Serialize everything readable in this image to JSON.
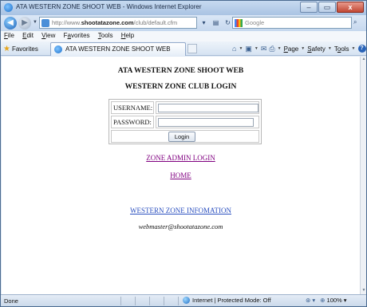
{
  "window": {
    "title": "ATA WESTERN ZONE SHOOT WEB - Windows Internet Explorer",
    "minimize": "–",
    "maximize": "▭",
    "close": "x"
  },
  "address": {
    "url_prefix": "http://www.",
    "url_domain": "shootatazone.com",
    "url_path": "/club/default.cfm",
    "search_placeholder": "Google"
  },
  "menu": [
    {
      "label": "File",
      "key": "F",
      "rest": "ile"
    },
    {
      "label": "Edit",
      "key": "E",
      "rest": "dit"
    },
    {
      "label": "View",
      "key": "V",
      "rest": "iew"
    },
    {
      "label": "Favorites",
      "pre": "F",
      "key": "a",
      "rest": "vorites"
    },
    {
      "label": "Tools",
      "key": "T",
      "rest": "ools"
    },
    {
      "label": "Help",
      "key": "H",
      "rest": "elp"
    }
  ],
  "favbar": {
    "favorites_label": "Favorites",
    "tab_title": "ATA WESTERN ZONE SHOOT WEB",
    "page_label": "Page",
    "safety_label": "Safety",
    "tools_label": "Tools"
  },
  "page": {
    "site_title": "ATA WESTERN ZONE SHOOT WEB",
    "login_title": "WESTERN ZONE CLUB LOGIN",
    "username_label": "USERNAME:",
    "password_label": "PASSWORD:",
    "login_button": "Login",
    "admin_link": "ZONE ADMIN LOGIN",
    "home_link": "HOME",
    "info_link": "WESTERN ZONE INFOMATION",
    "email": "webmaster@shootatazone.com"
  },
  "status": {
    "done": "Done",
    "zone": "Internet | Protected Mode: Off",
    "zoom": "100%"
  }
}
